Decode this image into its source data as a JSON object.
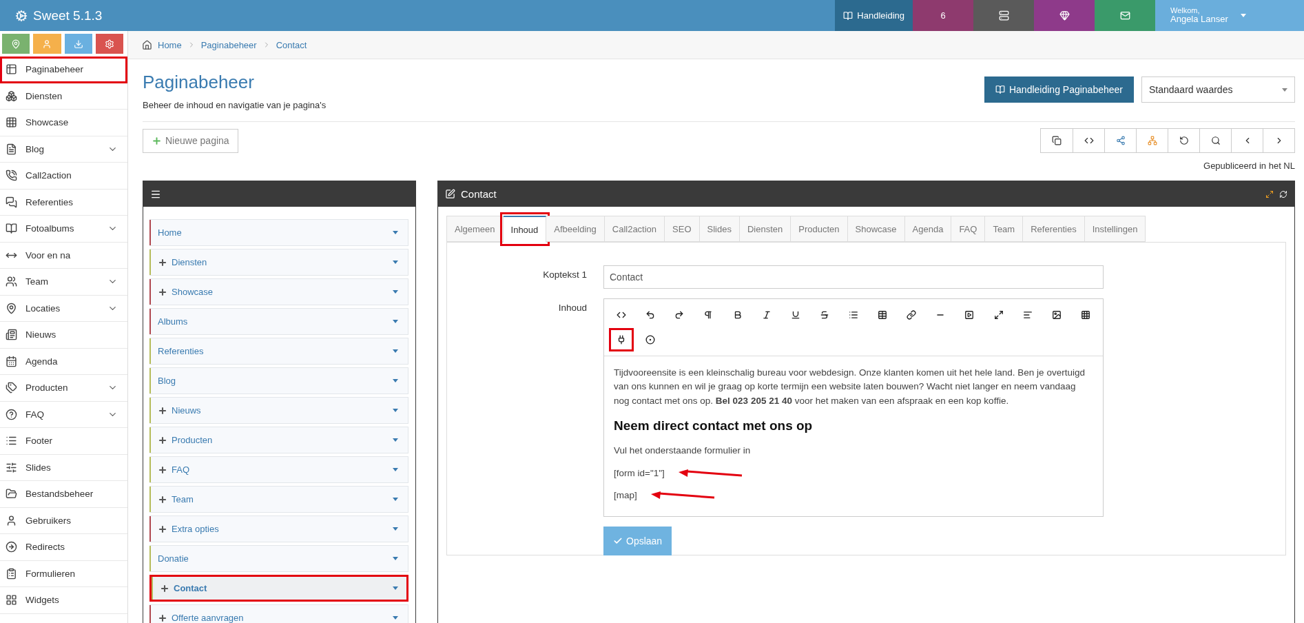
{
  "app": {
    "title": "Sweet 5.1.3"
  },
  "topbar": {
    "manual": "Handleiding",
    "badge": "6",
    "welcome": "Welkom,",
    "user": "Angela Lanser"
  },
  "quick_buttons": [
    {
      "color": "#7ab26f"
    },
    {
      "color": "#f5b04b"
    },
    {
      "color": "#6ab0e0"
    },
    {
      "color": "#d9534f"
    }
  ],
  "sidebar": {
    "items": [
      {
        "label": "Paginabeheer",
        "expandable": false,
        "highlighted": true
      },
      {
        "label": "Diensten",
        "expandable": false,
        "highlighted": false
      },
      {
        "label": "Showcase",
        "expandable": false,
        "highlighted": false
      },
      {
        "label": "Blog",
        "expandable": true,
        "highlighted": false
      },
      {
        "label": "Call2action",
        "expandable": false,
        "highlighted": false
      },
      {
        "label": "Referenties",
        "expandable": false,
        "highlighted": false
      },
      {
        "label": "Fotoalbums",
        "expandable": true,
        "highlighted": false
      },
      {
        "label": "Voor en na",
        "expandable": false,
        "highlighted": false
      },
      {
        "label": "Team",
        "expandable": true,
        "highlighted": false
      },
      {
        "label": "Locaties",
        "expandable": true,
        "highlighted": false
      },
      {
        "label": "Nieuws",
        "expandable": false,
        "highlighted": false
      },
      {
        "label": "Agenda",
        "expandable": false,
        "highlighted": false
      },
      {
        "label": "Producten",
        "expandable": true,
        "highlighted": false
      },
      {
        "label": "FAQ",
        "expandable": true,
        "highlighted": false
      },
      {
        "label": "Footer",
        "expandable": false,
        "highlighted": false
      },
      {
        "label": "Slides",
        "expandable": false,
        "highlighted": false
      },
      {
        "label": "Bestandsbeheer",
        "expandable": false,
        "highlighted": false
      },
      {
        "label": "Gebruikers",
        "expandable": false,
        "highlighted": false
      },
      {
        "label": "Redirects",
        "expandable": false,
        "highlighted": false
      },
      {
        "label": "Formulieren",
        "expandable": false,
        "highlighted": false
      },
      {
        "label": "Widgets",
        "expandable": false,
        "highlighted": false
      }
    ]
  },
  "breadcrumb": [
    "Home",
    "Paginabeheer",
    "Contact"
  ],
  "page": {
    "title": "Paginabeheer",
    "subtitle": "Beheer de inhoud en navigatie van je pagina's",
    "manual_button": "Handleiding Paginabeheer",
    "preset_select": "Standaard waardes",
    "new_page_button": "Nieuwe pagina",
    "status": "Gepubliceerd in het NL"
  },
  "tree": {
    "items": [
      {
        "label": "Home",
        "color": "#b0474f",
        "has_children": false,
        "selected": false,
        "highlighted": false
      },
      {
        "label": "Diensten",
        "color": "#b5bc5a",
        "has_children": true,
        "selected": false,
        "highlighted": false
      },
      {
        "label": "Showcase",
        "color": "#b0474f",
        "has_children": true,
        "selected": false,
        "highlighted": false
      },
      {
        "label": "Albums",
        "color": "#b0474f",
        "has_children": false,
        "selected": false,
        "highlighted": false
      },
      {
        "label": "Referenties",
        "color": "#b5bc5a",
        "has_children": false,
        "selected": false,
        "highlighted": false
      },
      {
        "label": "Blog",
        "color": "#b5bc5a",
        "has_children": false,
        "selected": false,
        "highlighted": false
      },
      {
        "label": "Nieuws",
        "color": "#b5bc5a",
        "has_children": true,
        "selected": false,
        "highlighted": false
      },
      {
        "label": "Producten",
        "color": "#b5bc5a",
        "has_children": true,
        "selected": false,
        "highlighted": false
      },
      {
        "label": "FAQ",
        "color": "#b5bc5a",
        "has_children": true,
        "selected": false,
        "highlighted": false
      },
      {
        "label": "Team",
        "color": "#b5bc5a",
        "has_children": true,
        "selected": false,
        "highlighted": false
      },
      {
        "label": "Extra opties",
        "color": "#b0474f",
        "has_children": true,
        "selected": false,
        "highlighted": false
      },
      {
        "label": "Donatie",
        "color": "#b5bc5a",
        "has_children": false,
        "selected": false,
        "highlighted": false
      },
      {
        "label": "Contact",
        "color": "#b5bc5a",
        "has_children": true,
        "selected": true,
        "highlighted": true
      },
      {
        "label": "Offerte aanvragen",
        "color": "#b0474f",
        "has_children": true,
        "selected": false,
        "highlighted": false
      }
    ]
  },
  "editor": {
    "title": "Contact",
    "tabs": [
      {
        "label": "Algemeen",
        "selected": false,
        "highlighted": false
      },
      {
        "label": "Inhoud",
        "selected": true,
        "highlighted": true
      },
      {
        "label": "Afbeelding",
        "selected": false,
        "highlighted": false
      },
      {
        "label": "Call2action",
        "selected": false,
        "highlighted": false
      },
      {
        "label": "SEO",
        "selected": false,
        "highlighted": false
      },
      {
        "label": "Slides",
        "selected": false,
        "highlighted": false
      },
      {
        "label": "Diensten",
        "selected": false,
        "highlighted": false
      },
      {
        "label": "Producten",
        "selected": false,
        "highlighted": false
      },
      {
        "label": "Showcase",
        "selected": false,
        "highlighted": false
      },
      {
        "label": "Agenda",
        "selected": false,
        "highlighted": false
      },
      {
        "label": "FAQ",
        "selected": false,
        "highlighted": false
      },
      {
        "label": "Team",
        "selected": false,
        "highlighted": false
      },
      {
        "label": "Referenties",
        "selected": false,
        "highlighted": false
      },
      {
        "label": "Instellingen",
        "selected": false,
        "highlighted": false
      }
    ],
    "heading_label": "Koptekst 1",
    "heading_value": "Contact",
    "content_label": "Inhoud",
    "toolbar": [
      {
        "highlighted": false
      },
      {
        "highlighted": false
      },
      {
        "highlighted": false
      },
      {
        "highlighted": false
      },
      {
        "highlighted": false
      },
      {
        "highlighted": false
      },
      {
        "highlighted": false
      },
      {
        "highlighted": false
      },
      {
        "highlighted": false
      },
      {
        "highlighted": false
      },
      {
        "highlighted": false
      },
      {
        "highlighted": false
      },
      {
        "highlighted": false
      },
      {
        "highlighted": false
      },
      {
        "highlighted": false
      },
      {
        "highlighted": false
      },
      {
        "highlighted": false
      },
      {
        "highlighted": true
      },
      {
        "highlighted": false
      }
    ],
    "content": [
      {
        "kind": "paragraph",
        "text": "Tijdvooreensite is een kleinschalig bureau voor webdesign. Onze klanten komen uit het hele land. Ben je overtuigd van ons kunnen en wil je graag op korte termijn een website laten bouwen? Wacht niet langer en neem vandaag nog contact met ons op. **Bel 023 205 21 40** voor het maken van een afspraak en een kop koffie.",
        "arrow": false
      },
      {
        "kind": "heading",
        "text": "Neem direct contact met ons op",
        "arrow": false
      },
      {
        "kind": "paragraph",
        "text": "Vul het onderstaande formulier in",
        "arrow": false
      },
      {
        "kind": "paragraph",
        "text": "[form id=\"1\"]",
        "arrow": true
      },
      {
        "kind": "paragraph",
        "text": "[map]",
        "arrow": true
      }
    ],
    "save_button": "Opslaan"
  }
}
